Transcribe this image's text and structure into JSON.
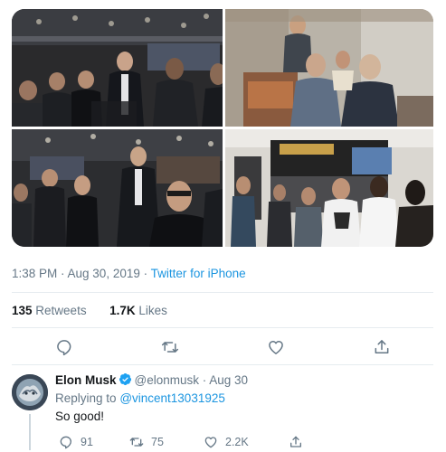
{
  "tweet": {
    "timestamp": "1:38 PM · Aug 30, 2019",
    "source": "Twitter for iPhone",
    "retweets_count": "135",
    "retweets_label": "Retweets",
    "likes_count": "1.7K",
    "likes_label": "Likes",
    "actions": [
      {
        "icon": "reply-icon"
      },
      {
        "icon": "retweet-icon"
      },
      {
        "icon": "like-icon"
      },
      {
        "icon": "share-icon"
      }
    ]
  },
  "reply": {
    "name": "Elon Musk",
    "handle": "@elonmusk",
    "date": "· Aug 30",
    "replying_prefix": "Replying to",
    "replying_to": "@vincent13031925",
    "text": "So good!",
    "reply_count": "91",
    "retweet_count": "75",
    "like_count": "2.2K"
  },
  "colors": {
    "link": "#1b95e0",
    "muted": "#657786",
    "text": "#14171a",
    "divider": "#e6ecf0"
  }
}
